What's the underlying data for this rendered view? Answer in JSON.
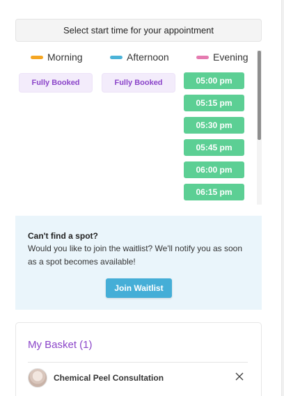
{
  "header": {
    "title": "Select start time for your appointment"
  },
  "columns": [
    {
      "label": "Morning",
      "color": "#f5a623",
      "booked_text": "Fully Booked"
    },
    {
      "label": "Afternoon",
      "color": "#4bb3d8",
      "booked_text": "Fully Booked"
    },
    {
      "label": "Evening",
      "color": "#e57bb0"
    }
  ],
  "slot_color": "#5ccf94",
  "evening_slots": [
    "05:00 pm",
    "05:15 pm",
    "05:30 pm",
    "05:45 pm",
    "06:00 pm",
    "06:15 pm"
  ],
  "waitlist": {
    "title": "Can't find a spot?",
    "message": "Would you like to join the waitlist? We'll notify you as soon as a spot becomes available!",
    "button_label": "Join Waitlist",
    "background": "#eaf5fb",
    "button_color": "#45aed7"
  },
  "basket": {
    "title": "My Basket (1)",
    "title_color": "#8b45c9",
    "items": [
      {
        "name": "Chemical Peel Consultation"
      }
    ]
  }
}
